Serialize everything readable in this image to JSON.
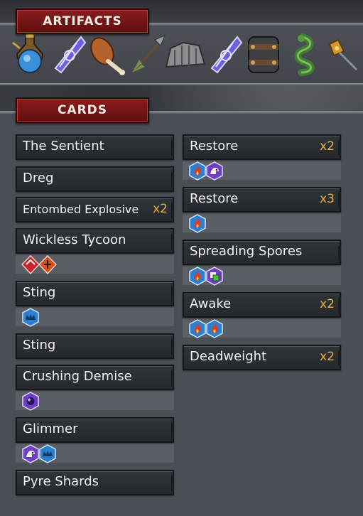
{
  "artifacts": {
    "title": "ARTIFACTS",
    "items": [
      {
        "icon": "blue-potion-flask-icon"
      },
      {
        "icon": "purple-crystal-shard-icon"
      },
      {
        "icon": "roasted-drumstick-icon"
      },
      {
        "icon": "feathered-arrow-icon"
      },
      {
        "icon": "stone-boulder-icon"
      },
      {
        "icon": "purple-crystal-shard-icon"
      },
      {
        "icon": "iron-bracer-icon"
      },
      {
        "icon": "green-serpent-icon"
      },
      {
        "icon": "bell-hammer-icon"
      }
    ]
  },
  "cards": {
    "title": "CARDS",
    "left": [
      {
        "name": "The Sentient",
        "count": "",
        "badges": []
      },
      {
        "name": "Dreg",
        "count": "",
        "badges": []
      },
      {
        "name": "Entombed Explosive",
        "count": "x2",
        "badges": []
      },
      {
        "name": "Wickless Tycoon",
        "count": "",
        "badges": [
          "red-diamond-icon",
          "orange-diamond-icon"
        ]
      },
      {
        "name": "Sting",
        "count": "",
        "badges": [
          "blue-crown-icon"
        ]
      },
      {
        "name": "Sting",
        "count": "",
        "badges": []
      },
      {
        "name": "Crushing Demise",
        "count": "",
        "badges": [
          "purple-orb-icon"
        ]
      },
      {
        "name": "Glimmer",
        "count": "",
        "badges": [
          "purple-creature-icon",
          "blue-crown-icon"
        ]
      },
      {
        "name": "Pyre Shards",
        "count": "",
        "badges": []
      }
    ],
    "right": [
      {
        "name": "Restore",
        "count": "x2",
        "badges": [
          "blue-flame-icon",
          "purple-creature-icon"
        ]
      },
      {
        "name": "Restore",
        "count": "x3",
        "badges": [
          "blue-flame-icon"
        ]
      },
      {
        "name": "Spreading Spores",
        "count": "",
        "badges": [
          "blue-flame-icon",
          "purple-green-square-icon"
        ]
      },
      {
        "name": "Awake",
        "count": "x2",
        "badges": [
          "blue-flame-icon",
          "blue-flame-icon"
        ]
      },
      {
        "name": "Deadweight",
        "count": "x2",
        "badges": []
      }
    ]
  },
  "colors": {
    "header_red": "#7a1818",
    "count_gold": "#e8b13c",
    "card_bar": "#2a2e33",
    "hex_blue": "#2c7fd0",
    "hex_purple": "#6c3fc2",
    "hex_red": "#c8242a"
  }
}
